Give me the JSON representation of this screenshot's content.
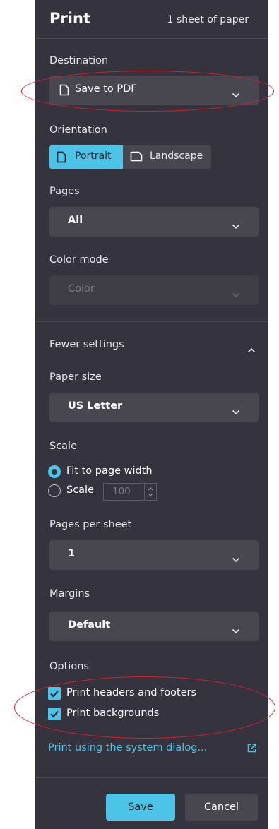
{
  "header": {
    "title": "Print",
    "sheet_count": "1 sheet of paper"
  },
  "destination": {
    "label": "Destination",
    "value": "Save to PDF"
  },
  "orientation": {
    "label": "Orientation",
    "portrait": "Portrait",
    "landscape": "Landscape",
    "selected": "Portrait"
  },
  "pages": {
    "label": "Pages",
    "value": "All"
  },
  "color_mode": {
    "label": "Color mode",
    "value": "Color"
  },
  "fewer_settings": {
    "label": "Fewer settings"
  },
  "paper_size": {
    "label": "Paper size",
    "value": "US Letter"
  },
  "scale": {
    "label": "Scale",
    "fit_option": "Fit to page width",
    "scale_option": "Scale",
    "scale_value": "100",
    "selected": "Fit to page width"
  },
  "pages_per_sheet": {
    "label": "Pages per sheet",
    "value": "1"
  },
  "margins": {
    "label": "Margins",
    "value": "Default"
  },
  "options": {
    "label": "Options",
    "headers_footers": "Print headers and footers",
    "backgrounds": "Print backgrounds"
  },
  "system_dialog_link": "Print using the system dialog...",
  "buttons": {
    "save": "Save",
    "cancel": "Cancel"
  },
  "colors": {
    "panel_bg": "#35343e",
    "accent": "#4cc4e8",
    "annotation": "#d6202a"
  }
}
